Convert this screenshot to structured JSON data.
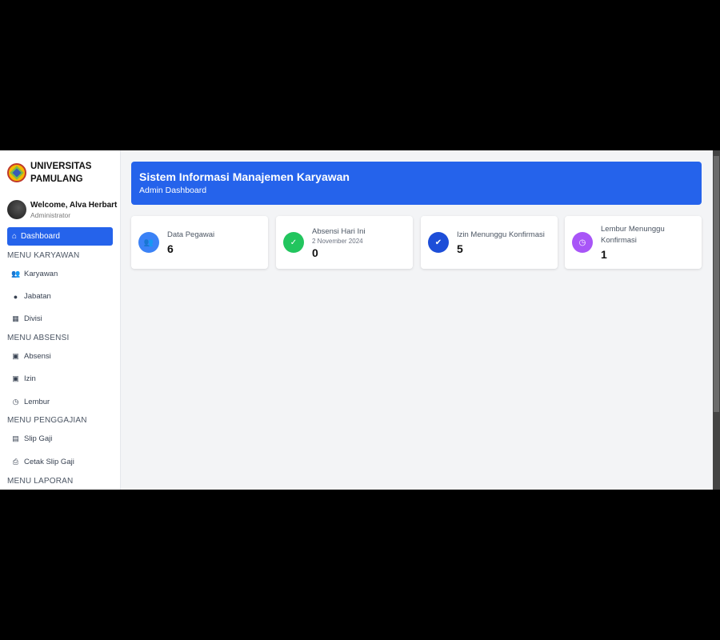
{
  "brand": {
    "line1": "UNIVERSITAS",
    "line2": "PAMULANG"
  },
  "user": {
    "welcome": "Welcome, Alva Herbart",
    "role": "Administrator"
  },
  "nav": {
    "dashboard": "Dashboard",
    "sections": [
      "MENU KARYAWAN",
      "MENU ABSENSI",
      "MENU PENGGAJIAN",
      "MENU LAPORAN"
    ],
    "karyawan": "Karyawan",
    "jabatan": "Jabatan",
    "divisi": "Divisi",
    "absensi": "Absensi",
    "izin": "Izin",
    "lembur": "Lembur",
    "slip_gaji": "Slip Gaji",
    "cetak_slip_gaji": "Cetak Slip Gaji"
  },
  "header": {
    "title": "Sistem Informasi Manajemen Karyawan",
    "subtitle": "Admin Dashboard"
  },
  "cards": [
    {
      "label": "Data Pegawai",
      "value": "6",
      "color": "#3b82f6",
      "icon": "users-icon"
    },
    {
      "label": "Absensi Hari Ini",
      "sub": "2 November 2024",
      "value": "0",
      "color": "#22c55e",
      "icon": "calendar-check-icon"
    },
    {
      "label": "Izin Menunggu Konfirmasi",
      "value": "5",
      "color": "#1d4ed8",
      "icon": "check-circle-icon"
    },
    {
      "label": "Lembur Menunggu Konfirmasi",
      "value": "1",
      "color": "#a855f7",
      "icon": "clock-icon"
    }
  ]
}
